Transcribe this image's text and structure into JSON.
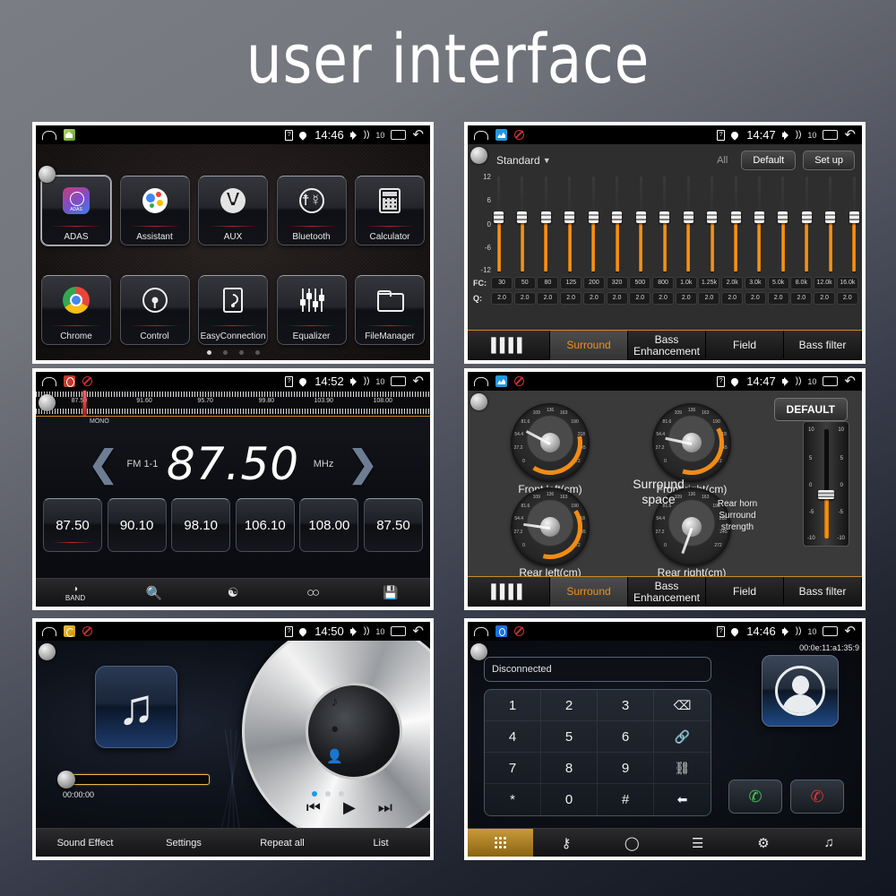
{
  "page": {
    "title": "user interface"
  },
  "panels": {
    "apps": {
      "status": {
        "time": "14:46",
        "volume": "10",
        "home_icon": "home-icon",
        "app_icon": "launcher-icon"
      },
      "items": [
        {
          "label": "ADAS",
          "icon": "adas-icon",
          "selected": true
        },
        {
          "label": "Assistant",
          "icon": "google-assistant-icon",
          "selected": false
        },
        {
          "label": "AUX",
          "icon": "aux-icon",
          "selected": false
        },
        {
          "label": "Bluetooth",
          "icon": "bluetooth-icon",
          "selected": false
        },
        {
          "label": "Calculator",
          "icon": "calculator-icon",
          "selected": false
        },
        {
          "label": "Chrome",
          "icon": "chrome-icon",
          "selected": false
        },
        {
          "label": "Control",
          "icon": "steering-wheel-icon",
          "selected": false
        },
        {
          "label": "EasyConnection",
          "icon": "easyconnection-icon",
          "selected": false
        },
        {
          "label": "Equalizer",
          "icon": "equalizer-icon",
          "selected": false
        },
        {
          "label": "FileManager",
          "icon": "folder-icon",
          "selected": false
        }
      ],
      "page_dots": 4,
      "active_dot": 0
    },
    "equalizer": {
      "status": {
        "time": "14:47",
        "volume": "10"
      },
      "preset": "Standard",
      "all_label": "All",
      "default_button": "Default",
      "setup_button": "Set up",
      "y_labels": [
        "12",
        "6",
        "0",
        "-6",
        "-12"
      ],
      "fc_label": "FC:",
      "q_label": "Q:",
      "bands": [
        {
          "fc": "30",
          "q": "2.0",
          "value": 0
        },
        {
          "fc": "50",
          "q": "2.0",
          "value": 0
        },
        {
          "fc": "80",
          "q": "2.0",
          "value": 0
        },
        {
          "fc": "125",
          "q": "2.0",
          "value": 0
        },
        {
          "fc": "200",
          "q": "2.0",
          "value": 0
        },
        {
          "fc": "320",
          "q": "2.0",
          "value": 0
        },
        {
          "fc": "500",
          "q": "2.0",
          "value": 0
        },
        {
          "fc": "800",
          "q": "2.0",
          "value": 0
        },
        {
          "fc": "1.0k",
          "q": "2.0",
          "value": 0
        },
        {
          "fc": "1.25k",
          "q": "2.0",
          "value": 0
        },
        {
          "fc": "2.0k",
          "q": "2.0",
          "value": 0
        },
        {
          "fc": "3.0k",
          "q": "2.0",
          "value": 0
        },
        {
          "fc": "5.0k",
          "q": "2.0",
          "value": 0
        },
        {
          "fc": "8.0k",
          "q": "2.0",
          "value": 0
        },
        {
          "fc": "12.0k",
          "q": "2.0",
          "value": 0
        },
        {
          "fc": "16.0k",
          "q": "2.0",
          "value": 0
        }
      ],
      "tabs": [
        {
          "label": "",
          "icon": "equalizer-sliders-icon",
          "active": false
        },
        {
          "label": "Surround",
          "active": true
        },
        {
          "label": "Bass Enhancement",
          "active": false
        },
        {
          "label": "Field",
          "active": false
        },
        {
          "label": "Bass filter",
          "active": false
        }
      ]
    },
    "radio": {
      "status": {
        "time": "14:52",
        "volume": "10"
      },
      "scale_labels": [
        "87.50",
        "91.60",
        "95.70",
        "99.80",
        "103.90",
        "108.00"
      ],
      "mono_label": "MONO",
      "band": "FM 1-1",
      "frequency": "87.50",
      "unit": "MHz",
      "presets": [
        "87.50",
        "90.10",
        "98.10",
        "106.10",
        "108.00",
        "87.50"
      ],
      "current_preset": 0,
      "toolbar": [
        {
          "label": "BAND",
          "icon": "band-icon"
        },
        {
          "label": "",
          "icon": "scan-search-icon"
        },
        {
          "label": "",
          "icon": "antenna-icon"
        },
        {
          "label": "",
          "icon": "stereo-icon"
        },
        {
          "label": "",
          "icon": "save-icon"
        }
      ]
    },
    "surround": {
      "status": {
        "time": "14:47",
        "volume": "10"
      },
      "default_button": "DEFAULT",
      "center_label": "Surround space",
      "knobs": [
        {
          "label": "Front left(cm)",
          "angle": -152
        },
        {
          "label": "Front right(cm)",
          "angle": -168
        },
        {
          "label": "Rear left(cm)",
          "angle": -172
        },
        {
          "label": "Rear right(cm)",
          "angle": 110
        }
      ],
      "knob_ticks": [
        "0",
        "27.2",
        "54.4",
        "81.6",
        "109",
        "136",
        "163",
        "190",
        "218",
        "245",
        "272"
      ],
      "rear_horn_label": "Rear horn Surround strength",
      "slider_labels": [
        "10",
        "5",
        "0",
        "-5",
        "-10"
      ],
      "tabs": [
        {
          "label": "",
          "icon": "equalizer-sliders-icon",
          "active": false
        },
        {
          "label": "Surround",
          "active": true
        },
        {
          "label": "Bass Enhancement",
          "active": false
        },
        {
          "label": "Field",
          "active": false
        },
        {
          "label": "Bass filter",
          "active": false
        }
      ]
    },
    "music": {
      "status": {
        "time": "14:50",
        "volume": "10"
      },
      "elapsed": "00:00:00",
      "progress_percent": 0,
      "disc_icons": [
        "music-note-icon",
        "album-icon",
        "artist-icon"
      ],
      "page_dots": 3,
      "active_dot": 0,
      "controls": [
        "previous-icon",
        "play-icon",
        "next-icon"
      ],
      "toolbar": [
        "Sound Effect",
        "Settings",
        "Repeat all",
        "List"
      ]
    },
    "bluetooth": {
      "status": {
        "time": "14:46",
        "volume": "10"
      },
      "mac_address": "00:0e:11:a1:35:9",
      "connection_status": "Disconnected",
      "keys": [
        "1",
        "2",
        "3",
        "backspace-icon",
        "4",
        "5",
        "6",
        "link-icon",
        "7",
        "8",
        "9",
        "unlink-icon",
        "*",
        "0",
        "#",
        "transfer-icon"
      ],
      "call_buttons": [
        "answer-call-icon",
        "end-call-icon"
      ],
      "toolbar": [
        "keypad-icon",
        "contacts-icon",
        "history-icon",
        "records-icon",
        "settings-icon",
        "music-icon"
      ],
      "active_tab": 0
    }
  }
}
